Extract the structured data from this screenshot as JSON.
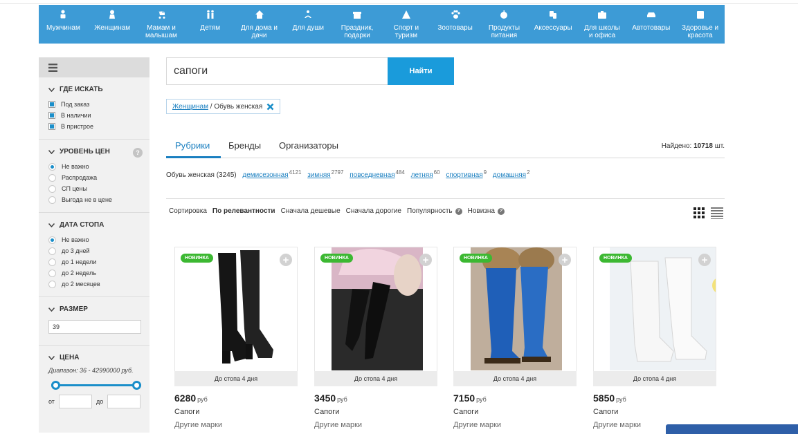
{
  "categories": [
    {
      "label": "Мужчинам",
      "icon": "male-icon"
    },
    {
      "label": "Женщинам",
      "icon": "female-icon"
    },
    {
      "label": "Мамам и\nмалышам",
      "icon": "stroller-icon"
    },
    {
      "label": "Детям",
      "icon": "children-icon"
    },
    {
      "label": "Для дома и\nдачи",
      "icon": "house-icon"
    },
    {
      "label": "Для души",
      "icon": "soul-icon"
    },
    {
      "label": "Праздник,\nподарки",
      "icon": "gift-icon"
    },
    {
      "label": "Спорт и\nтуризм",
      "icon": "tent-icon"
    },
    {
      "label": "Зоотовары",
      "icon": "paw-icon"
    },
    {
      "label": "Продукты\nпитания",
      "icon": "apple-icon"
    },
    {
      "label": "Аксессуары",
      "icon": "accessories-icon"
    },
    {
      "label": "Для школы\nи офиса",
      "icon": "briefcase-icon"
    },
    {
      "label": "Автотовары",
      "icon": "car-icon"
    },
    {
      "label": "Здоровье и\nкрасота",
      "icon": "cosmetics-icon"
    }
  ],
  "sidebar": {
    "where": {
      "title": "ГДЕ ИСКАТЬ",
      "options": [
        "Под заказ",
        "В наличии",
        "В пристрое"
      ]
    },
    "price_level": {
      "title": "УРОВЕНЬ ЦЕН",
      "help": "?",
      "options": [
        "Не важно",
        "Распродажа",
        "СП цены",
        "Выгода не в цене"
      ],
      "selected": 0
    },
    "stop_date": {
      "title": "ДАТА СТОПА",
      "options": [
        "Не важно",
        "до 3 дней",
        "до 1 недели",
        "до 2 недель",
        "до 2 месяцев"
      ],
      "selected": 0
    },
    "size": {
      "title": "РАЗМЕР",
      "value": "39"
    },
    "price": {
      "title": "ЦЕНА",
      "range": "Диапазон: 36 - 42990000 руб.",
      "from_label": "от",
      "to_label": "до",
      "slider_min_fraction": 0,
      "slider_max_fraction": 1
    }
  },
  "search": {
    "value": "сапоги",
    "button": "Найти"
  },
  "breadcrumb": {
    "link": "Женщинам",
    "sep": " / ",
    "current": "Обувь женская"
  },
  "tabs": [
    "Рубрики",
    "Бренды",
    "Организаторы"
  ],
  "found": {
    "label": "Найдено:",
    "count": "10718",
    "unit": "шт."
  },
  "rubrics": {
    "main": "Обувь женская (3245)",
    "items": [
      {
        "label": "демисезонная",
        "count": "4121"
      },
      {
        "label": "зимняя",
        "count": "2797"
      },
      {
        "label": "повседневная",
        "count": "484"
      },
      {
        "label": "летняя",
        "count": "60"
      },
      {
        "label": "спортивная",
        "count": "9"
      },
      {
        "label": "домашняя",
        "count": "2"
      }
    ]
  },
  "sort": {
    "label": "Сортировка",
    "options": [
      "По релевантности",
      "Сначала дешевые",
      "Сначала дорогие",
      "Популярность",
      "Новизна"
    ],
    "selected": 0
  },
  "products": [
    {
      "badge": "НОВИНКА",
      "stop": "До стопа 4 дня",
      "price": "6280",
      "currency": "руб",
      "name": "Сапоги",
      "brand": "Другие марки",
      "image": "black-boots"
    },
    {
      "badge": "НОВИНКА",
      "stop": "До стопа 4 дня",
      "price": "3450",
      "currency": "руб",
      "name": "Сапоги",
      "brand": "Другие марки",
      "image": "over-knee-boots"
    },
    {
      "badge": "НОВИНКА",
      "stop": "До стопа 4 дня",
      "price": "7150",
      "currency": "руб",
      "name": "Сапоги",
      "brand": "Другие марки",
      "image": "blue-suede-boots"
    },
    {
      "badge": "НОВИНКА",
      "stop": "До стопа 4 дня",
      "price": "5850",
      "currency": "руб",
      "name": "Сапоги",
      "brand": "Другие марки",
      "image": "white-perforated-boots"
    }
  ],
  "colors": {
    "nav": "#3d9bd6",
    "accent": "#1a9bdb",
    "badge": "#3cb832"
  }
}
